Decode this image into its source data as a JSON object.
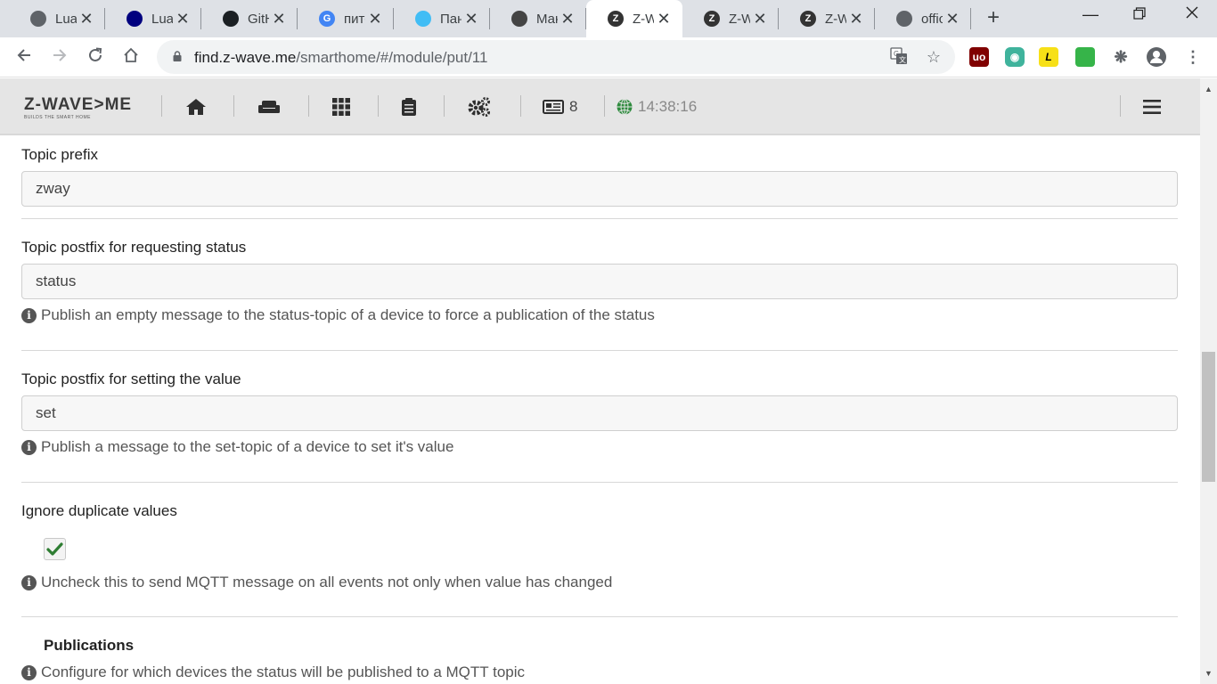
{
  "browser": {
    "tabs": [
      {
        "title": "LuaS",
        "icon": "globe-icon",
        "color": "#5f6368",
        "active": false
      },
      {
        "title": "Lua",
        "icon": "lua-logo-icon",
        "color": "#00007f",
        "active": false
      },
      {
        "title": "GitH",
        "icon": "github-icon",
        "color": "#1b1f23",
        "active": false
      },
      {
        "title": "питс",
        "icon": "google-icon",
        "color": "#4285f4",
        "active": false
      },
      {
        "title": "Пан",
        "icon": "home-assistant-icon",
        "color": "#41bdf5",
        "active": false
      },
      {
        "title": "Мак",
        "icon": "mascot-icon",
        "color": "#444444",
        "active": false
      },
      {
        "title": "Z-W",
        "icon": "zwave-icon",
        "color": "#333333",
        "active": true
      },
      {
        "title": "Z-W",
        "icon": "zwave-icon",
        "color": "#333333",
        "active": false
      },
      {
        "title": "Z-W",
        "icon": "zwave-icon",
        "color": "#333333",
        "active": false
      },
      {
        "title": "offic",
        "icon": "globe-icon",
        "color": "#5f6368",
        "active": false
      }
    ],
    "url_host": "find.z-wave.me",
    "url_path": "/smarthome/#/module/put/11"
  },
  "header": {
    "logo": "Z-WAVE>ME",
    "logo_tagline": "BUILDS THE SMART HOME",
    "notifications_count": "8",
    "time": "14:38:16"
  },
  "form": {
    "topic_prefix": {
      "label": "Topic prefix",
      "value": "zway"
    },
    "status_postfix": {
      "label": "Topic postfix for requesting status",
      "value": "status",
      "help": "Publish an empty message to the status-topic of a device to force a publication of the status"
    },
    "set_postfix": {
      "label": "Topic postfix for setting the value",
      "value": "set",
      "help": "Publish a message to the set-topic of a device to set it's value"
    },
    "ignore_duplicates": {
      "label": "Ignore duplicate values",
      "checked": true,
      "help": "Uncheck this to send MQTT message on all events not only when value has changed"
    },
    "publications": {
      "title": "Publications",
      "help": "Configure for which devices the status will be published to a MQTT topic"
    }
  },
  "colors": {
    "header_bg": "#e5e5e5",
    "checkmark": "#2e7d32",
    "info_icon": "#555555"
  }
}
